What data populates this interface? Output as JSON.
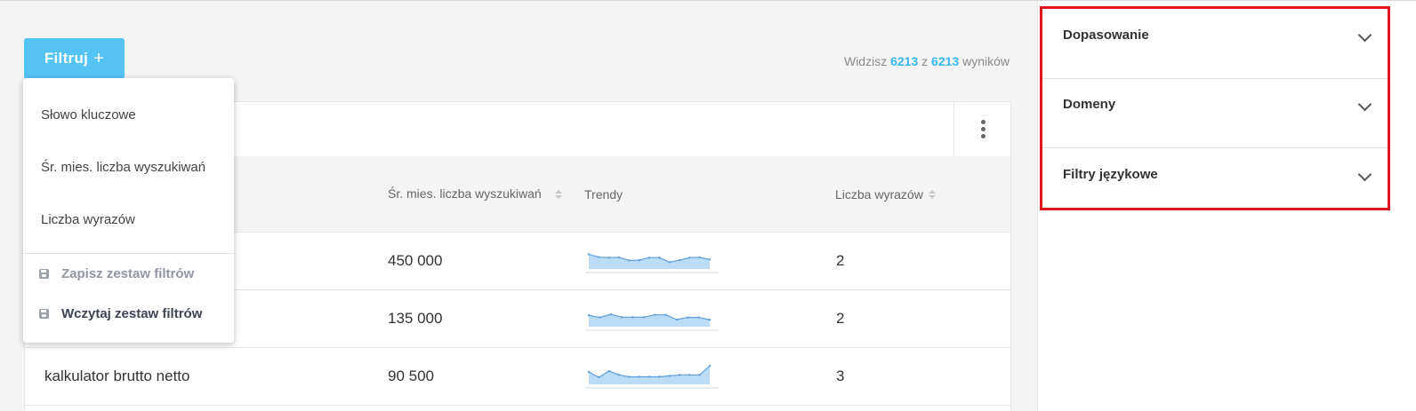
{
  "filter_button": {
    "label": "Filtruj",
    "plus": "+"
  },
  "results": {
    "prefix": "Widzisz",
    "shown": "6213",
    "sep": "z",
    "total": "6213",
    "suffix": "wyników"
  },
  "table": {
    "columns": {
      "search_volume": "Śr. mies. liczba wyszukiwań",
      "trend": "Trendy",
      "words": "Liczba wyrazów"
    },
    "rows": [
      {
        "keyword": "",
        "volume": "450 000",
        "words": "2",
        "trend": [
          6.2,
          5.0,
          4.8,
          4.9,
          3.6,
          3.7,
          4.8,
          4.8,
          2.9,
          3.7,
          4.8,
          4.9,
          4.0
        ]
      },
      {
        "keyword": "",
        "volume": "135 000",
        "words": "2",
        "trend": [
          4.8,
          3.9,
          5.2,
          4.0,
          4.0,
          4.0,
          5.0,
          5.0,
          3.0,
          3.9,
          3.9,
          2.9
        ]
      },
      {
        "keyword": "kalkulator brutto netto",
        "volume": "90 500",
        "words": "3",
        "trend": [
          5.2,
          3.0,
          5.6,
          4.0,
          3.2,
          3.2,
          3.2,
          3.2,
          3.6,
          4.0,
          4.0,
          4.0,
          7.8
        ]
      }
    ]
  },
  "dropdown": {
    "items": [
      "Słowo kluczowe",
      "Śr. mies. liczba wyszukiwań",
      "Liczba wyrazów"
    ],
    "save_label": "Zapisz zestaw filtrów",
    "load_label": "Wczytaj zestaw filtrów",
    "icon": "floppy-disk-icon"
  },
  "panel": {
    "sections": [
      "Dopasowanie",
      "Domeny",
      "Filtry językowe"
    ]
  },
  "colors": {
    "accent": "#55c4f5",
    "highlight_box": "#e1141e",
    "spark_fill": "#bcdcf6",
    "spark_line": "#5d9fdc"
  }
}
